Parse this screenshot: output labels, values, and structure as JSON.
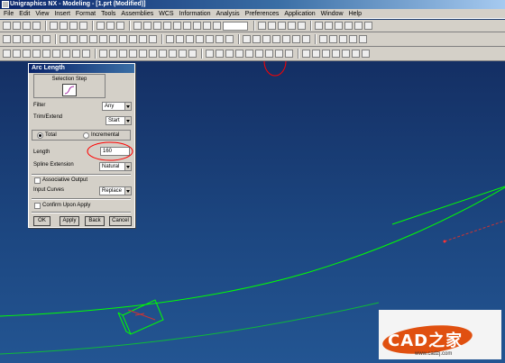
{
  "window": {
    "title": "Unigraphics NX - Modeling - [1.prt (Modified)]"
  },
  "menu": [
    "File",
    "Edit",
    "View",
    "Insert",
    "Format",
    "Tools",
    "Assemblies",
    "WCS",
    "Information",
    "Analysis",
    "Preferences",
    "Application",
    "Window",
    "Help"
  ],
  "dialog": {
    "title": "Arc Length",
    "selection_step": "Selection Step",
    "filter": {
      "label": "Filter",
      "value": "Any"
    },
    "trim_extend": {
      "label": "Trim/Extend",
      "value": "Start"
    },
    "mode": {
      "total": "Total",
      "incremental": "Incremental",
      "selected": "Total"
    },
    "length": {
      "label": "Length",
      "value": "160"
    },
    "spline_extension": {
      "label": "Spline Extension",
      "value": "Natural"
    },
    "associative_output": {
      "label": "Associative Output",
      "checked": false
    },
    "input_curves": {
      "label": "Input Curves",
      "value": "Replace"
    },
    "confirm": {
      "label": "Confirm Upon Apply",
      "checked": false
    },
    "buttons": {
      "ok": "OK",
      "apply": "Apply",
      "back": "Back",
      "cancel": "Cancel"
    }
  },
  "watermark": {
    "text": "CAD之家",
    "sub": "www.cadzj.com"
  },
  "colors": {
    "curve": "#00ff00",
    "highlight": "#ff0000",
    "viewport": "#1c4680"
  }
}
